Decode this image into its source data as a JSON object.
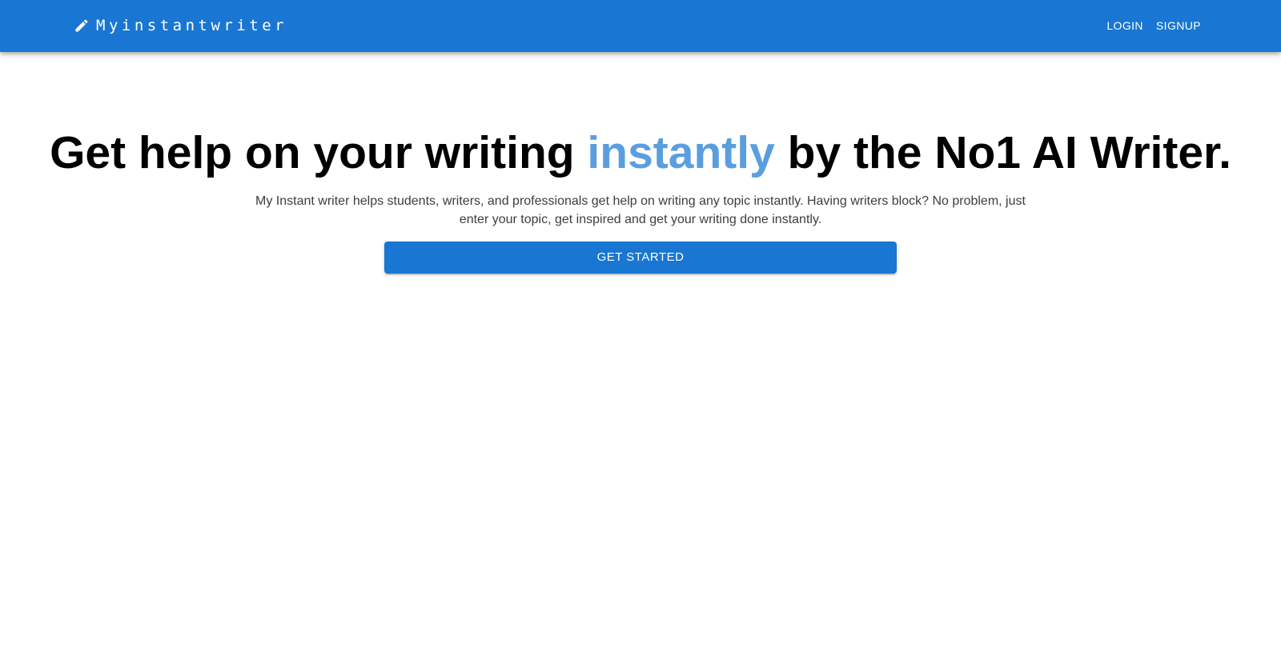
{
  "header": {
    "brand_icon": "pencil-icon",
    "brand_name": "Myinstantwriter",
    "login_label": "LOGIN",
    "signup_label": "SIGNUP"
  },
  "hero": {
    "title_before": "Get help on your writing ",
    "title_accent": "instantly",
    "title_after": " by the No1 AI Writer.",
    "description": "My Instant writer helps students, writers, and professionals get help on writing any topic instantly. Having writers block? No problem, just enter your topic, get inspired and get your writing done instantly.",
    "cta_label": "GET STARTED"
  },
  "colors": {
    "primary": "#1976d2",
    "accent_text": "#5a9ee0"
  }
}
